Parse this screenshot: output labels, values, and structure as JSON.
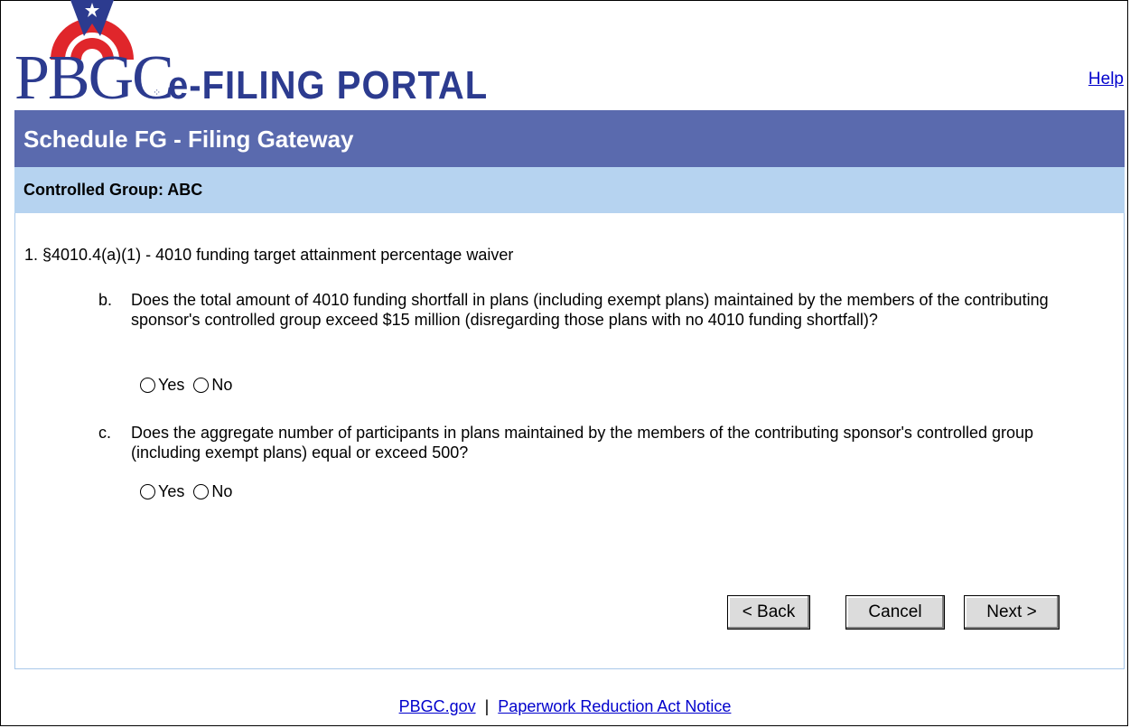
{
  "header": {
    "logo_text": "PBGC",
    "logo_subtitle": "e-FILING PORTAL",
    "help_link": "Help"
  },
  "title_bar": {
    "title": "Schedule FG - Filing Gateway"
  },
  "group_bar": {
    "label": "Controlled Group: ABC"
  },
  "main": {
    "question_1": "1. §4010.4(a)(1) - 4010 funding target attainment percentage waiver",
    "sub_b": {
      "letter": "b.",
      "text": "Does the total amount of 4010 funding shortfall in plans (including exempt plans) maintained by the members of the contributing sponsor's controlled group exceed $15 million (disregarding those plans with no 4010 funding shortfall)?",
      "yes": "Yes",
      "no": "No"
    },
    "sub_c": {
      "letter": "c.",
      "text": "Does the aggregate number of participants in plans maintained by the members of the contributing sponsor's controlled group (including exempt plans) equal or exceed 500?",
      "yes": "Yes",
      "no": "No"
    }
  },
  "buttons": {
    "back": "< Back",
    "cancel": "Cancel",
    "next": "Next >"
  },
  "footer": {
    "link_pbgc": "PBGC.gov",
    "separator": "|",
    "link_paperwork": "Paperwork Reduction Act Notice"
  },
  "colors": {
    "title_bar": "#5a6aae",
    "group_bar": "#b6d3f0",
    "logo_blue": "#2c3b8f",
    "logo_red": "#e0262b",
    "link": "#0000cc"
  }
}
